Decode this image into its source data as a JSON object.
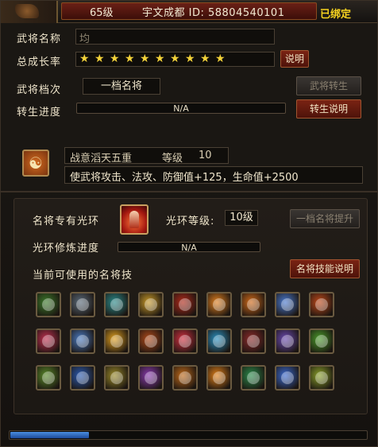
{
  "header": {
    "level": "65级",
    "name_id": "宇文成都 ID: 58804540101",
    "bound": "已绑定"
  },
  "general": {
    "name_label": "武将名称",
    "name_value": "均",
    "growth_label": "总成长率",
    "stars": [
      "★",
      "★",
      "★",
      "★",
      "★",
      "★",
      "★",
      "★",
      "★",
      "★"
    ],
    "growth_explain_btn": "说明",
    "tier_label": "武将档次",
    "tier_value": "一档名将",
    "transfer_btn": "武将转生",
    "transfer_progress_label": "转生进度",
    "transfer_progress_text": "N/A",
    "transfer_explain_btn": "转生说明"
  },
  "skill": {
    "name": "战意滔天五重",
    "level_label": "等级",
    "level_value": "10",
    "description": "使武将攻击、法攻、防御值+125，生命值+2500"
  },
  "halo": {
    "title": "名将专有光环",
    "level_label": "光环等级:",
    "level_value": "10级",
    "upgrade_btn": "一档名将提升",
    "refine_label": "光环修炼进度",
    "refine_text": "N/A",
    "available_label": "当前可使用的名将技",
    "skill_explain_btn": "名将技能说明"
  },
  "skills": [
    {
      "name": "skill-1",
      "color": "#3c7a2a"
    },
    {
      "name": "skill-2",
      "color": "#5a6a7a"
    },
    {
      "name": "skill-3",
      "color": "#2a8a8a"
    },
    {
      "name": "skill-4",
      "color": "#c89a2a"
    },
    {
      "name": "skill-5",
      "color": "#b02a1a"
    },
    {
      "name": "skill-6",
      "color": "#e08020"
    },
    {
      "name": "skill-7",
      "color": "#d06a1a"
    },
    {
      "name": "skill-8",
      "color": "#4a7ad0"
    },
    {
      "name": "skill-9",
      "color": "#c04a1a"
    },
    {
      "name": "skill-10",
      "color": "#c03050"
    },
    {
      "name": "skill-11",
      "color": "#4a7ac0"
    },
    {
      "name": "skill-12",
      "color": "#e0a020"
    },
    {
      "name": "skill-13",
      "color": "#b04a1a"
    },
    {
      "name": "skill-14",
      "color": "#d03040"
    },
    {
      "name": "skill-15",
      "color": "#2a90c0"
    },
    {
      "name": "skill-16",
      "color": "#8a2a2a"
    },
    {
      "name": "skill-17",
      "color": "#6a4ab0"
    },
    {
      "name": "skill-18",
      "color": "#4a9a2a"
    },
    {
      "name": "skill-19",
      "color": "#5a8a2a"
    },
    {
      "name": "skill-20",
      "color": "#2a5ab0"
    },
    {
      "name": "skill-21",
      "color": "#9a8a2a"
    },
    {
      "name": "skill-22",
      "color": "#8a3ab0"
    },
    {
      "name": "skill-23",
      "color": "#c06a1a"
    },
    {
      "name": "skill-24",
      "color": "#e0801a"
    },
    {
      "name": "skill-25",
      "color": "#2a8a4a"
    },
    {
      "name": "skill-26",
      "color": "#3a6ad0"
    },
    {
      "name": "skill-27",
      "color": "#8aa02a"
    }
  ],
  "bottom_progress": {
    "fraction": 0.22
  }
}
